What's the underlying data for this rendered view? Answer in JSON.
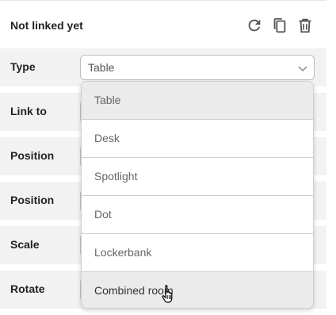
{
  "header": {
    "title": "Not linked yet",
    "icons": [
      "refresh-icon",
      "copy-icon",
      "delete-icon"
    ]
  },
  "rows": {
    "type": "Type",
    "link_to": "Link to",
    "position_1": "Position",
    "position_2": "Position",
    "scale": "Scale",
    "rotate": "Rotate"
  },
  "type_select": {
    "value": "Table",
    "options": [
      "Table",
      "Desk",
      "Spotlight",
      "Dot",
      "Lockerbank",
      "Combined room"
    ],
    "selected": "Table",
    "hovered": "Combined room"
  },
  "colors": {
    "row_bg": "#f2f2f2",
    "icon": "#555555",
    "highlight": "#ebebeb"
  }
}
